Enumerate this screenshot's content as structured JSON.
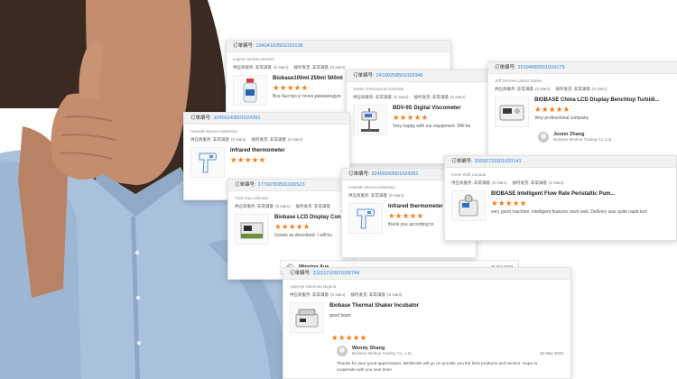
{
  "labels": {
    "order_prefix": "订单编号:",
    "supplier_service": "供应商服务: 非常满意",
    "shipping_speed": "按时发货: 非常满意",
    "five_stars": "(5 stars)"
  },
  "colors": {
    "star": "#f47c1b",
    "link": "#2a7fd4",
    "header_bg": "#f2f2f2"
  },
  "cards": [
    {
      "order_no": "19404163501023138",
      "buyer": "evgenii lanfrak,Ukraine",
      "product": "Biobase100ml 250ml 500ml",
      "stars": "★★★★★",
      "comment": "Все быстро и точно,рекомендую",
      "thumb_icon": "bottle-icon"
    },
    {
      "order_no": "24190258501023346",
      "buyer": "Jessie Greenwood,Australia",
      "product": "BDV-9S Digital Viscometer",
      "stars": "★★★★★",
      "comment": "Very happy with our equipment.  Will be",
      "thumb_icon": "viscometer-icon"
    },
    {
      "order_no": "25194682501024179",
      "buyer": "Jeff DeVries,United States",
      "product": "BIOBASE China LCD Display Benchtop Turbidi...",
      "stars": "★★★★★",
      "comment": "Very professional company",
      "thumb_icon": "turbidimeter-icon",
      "reply_name": "Joonn Zhang",
      "reply_company": "Biobase Meihua Trading Co.,Ltd."
    },
    {
      "order_no": "32450243001024391",
      "buyer": "Hamsah Bunon,Indonesia",
      "product": "Infrared thermometer",
      "stars": "★★★★★",
      "thumb_icon": "thermometer-icon"
    },
    {
      "order_no": "17760783501026523",
      "buyer": "Tuan Dao,Vietnam",
      "product": "Biobase LCD Display Con",
      "stars": "★★★★★",
      "comment": "Goods as described. I will bu",
      "thumb_icon": "analyzer-icon",
      "reply_name": "Winston Xue",
      "reply_date": "25 Oct 2019"
    },
    {
      "order_no": "32450243001024391",
      "buyer": "Hamsah Bunon,Indonesia",
      "product": "Infrared thermometer",
      "stars": "★★★★★",
      "comment": "thank you according to",
      "thumb_icon": "thermometer-icon"
    },
    {
      "order_no": "33092731001020141",
      "buyer": "Kevin Wolf,Canada",
      "product": "BIOBASE Intelligent Flow Rate Peristaltic Pum...",
      "stars": "★★★★★",
      "comment": "very good machine, intelligent features work well. Delivery was quite rapid too!",
      "thumb_icon": "pump-icon"
    },
    {
      "order_no": "31151210001026744",
      "buyer": "Adeyeju Hammed,Nigeria",
      "product": "Biobase Thermal Shaker Incubator",
      "stars": "★★★★★",
      "comment": "good team",
      "thumb_icon": "shaker-icon",
      "reply_name": "Wendy Shang",
      "reply_company": "Biobase Meihua Trading Co., Ltd.",
      "reply_date": "26 May 2020",
      "reply_text_1": "Thanks for your good appreciation, BIOBASE will go on provide you the best products and service. Hope to",
      "reply_text_2": "cooperate with you next time!"
    }
  ]
}
